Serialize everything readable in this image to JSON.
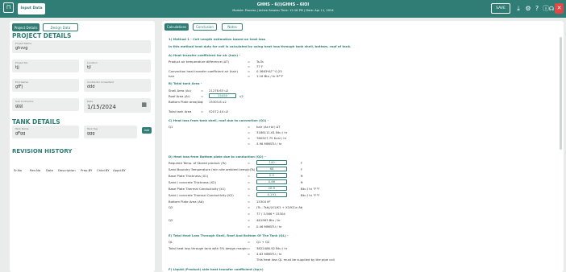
{
  "topbar": {
    "input_label": "Input Data",
    "title": "GHHS - 6(i)GHHS - 6IOI",
    "subtitle": "Module: Process | Active Session Time: 12:16 PM | Date: Apr 11, 2024",
    "save_label": "SAVE",
    "close_label": "✕"
  },
  "left_tabs": {
    "project": "Project Details",
    "design": "Design Data"
  },
  "project": {
    "heading": "PROJECT DETAILS",
    "name_label": "Project Name",
    "name": "ghvvg",
    "no_label": "Project No.",
    "no": "tjj",
    "loc_label": "Location",
    "loc": "tjl",
    "owner_label": "End Owner",
    "owner": "gfFj",
    "cons_label": "Contractor Consultant",
    "cons": "ddd",
    "sub_label": "Sub Contractor",
    "sub": "gjgj",
    "date_label": "Date",
    "date": "1/15/2024"
  },
  "tank": {
    "heading": "TANK DETAILS",
    "name_label": "Tank Name",
    "name": "gFgg",
    "tag_label": "Tank Tag",
    "tag": "ggg"
  },
  "revision": {
    "heading": "REVISION HISTORY",
    "add_label": "Add",
    "columns": [
      "Sr.No",
      "Rev.No",
      "Date",
      "Description",
      "Prep.BY",
      "Chkd.BY",
      "Appd.BY"
    ]
  },
  "right_tabs": {
    "calc": "Calculations",
    "concl": "Conclusion",
    "notes": "Notes"
  },
  "calc": {
    "m1": "1) Method 1 - Coil Length estimation based on heat loss",
    "m1_desc": "In this method heat duty for coil is calculated by using heat loss through tank shell, bottom, roof of tank.",
    "sA": "A) Heat transfer coefficient for air (hair) -",
    "a1": "Product air temperature difference (ΔT)",
    "a1v": "Ts-Ta",
    "a1v2": "77   F",
    "a2": "Convection heat transfer coefficient air (hair)",
    "a2v": "0.3663*ΔT^0.25",
    "a3": "hair",
    "a3v": "1.16    Btu / hr ft²°F",
    "sB": "B) Total tank Area -",
    "b1": "Shell Area (As)",
    "b1v": "21278.63   u2",
    "b2": "Roof Area (Ar)",
    "b2v": "15450",
    "b2u": "u2",
    "b3": "Bottom Plate area(Ab)",
    "b3v": "15303.8   u2",
    "b4": "Total tank Area",
    "b4v": "52072.44   u2",
    "sC": "C) Heat loss from tank shell, roof due to convection (Q1) -",
    "c1": "Q1",
    "c1v": "hair (As+Ar) ΔT",
    "c2": "3186111.61   Btu / hr",
    "c3": "780927.75   Kcal / hr",
    "c4": "3.98   MMBTU / hr",
    "sD": "D) Heat loss from Bottom plate due to conduction (Q2) -",
    "d1": "Required Temp. of Stored product (Ts)",
    "d1v": "140",
    "d1u": "F",
    "d2": "Sand Boundry Temperature (min site ambient temp) (Ts)",
    "d2v": "68",
    "d2u": "F",
    "d3": "Base Plate Thickness (X1)",
    "d3v": "0.5",
    "d3u": "ft",
    "d4": "Sand / concrete Thickness (X2)",
    "d4v": "0.66",
    "d4u": "ft",
    "d5": "Base Plate Thermal Conductivity (k1)",
    "d5v": "28.9",
    "d5u": "Btu / hr °F°F",
    "d6": "Sand / concrete Thermal Conductivity (K2)",
    "d6v": "0.191",
    "d6u": "Btu / hr °F°F",
    "d7": "Bottom Plate Area (Ab)",
    "d7v": "15304   ft²",
    "d8": "Q2",
    "d8v": "(Ts - Tsb)/(X1/K1 + X2/K2)x Ab",
    "d9": "77 / 3.566 * 15304",
    "d10": "Q2",
    "d10v": "461963   Btu / hr",
    "d11": "0.46   MMBTU / hr",
    "sE": "E) Total Heat Loss Through Shell, Roof And Bottom Of The Tank (QL) -",
    "e1": "QL",
    "e1v": "Q1 + Q2",
    "e2": "Total heat loss through tank with 5% design margin",
    "e2v": "3822486.92   Btu / hr",
    "e3": "4.83   MMBTU / hr",
    "e4": "This heat loss QL must be supplied by the pipe coil",
    "sF": "F) Liquid (Product) side heat transfer coefficient (hp/c)"
  }
}
